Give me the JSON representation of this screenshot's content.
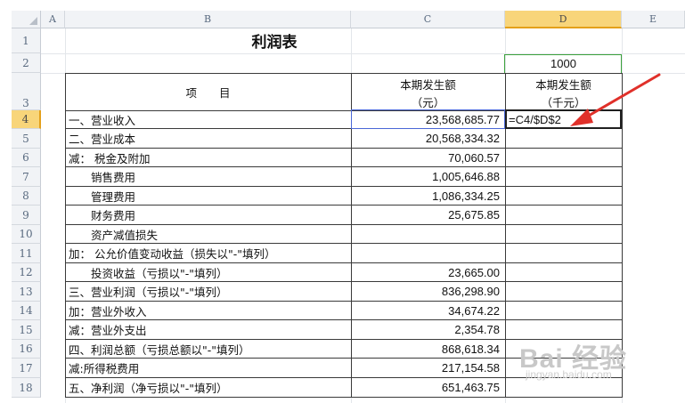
{
  "columns": [
    "A",
    "B",
    "C",
    "D",
    "E"
  ],
  "selected_column": "D",
  "rows": [
    "1",
    "2",
    "3",
    "4",
    "5",
    "6",
    "7",
    "8",
    "9",
    "10",
    "11",
    "12",
    "13",
    "14",
    "15",
    "16",
    "17",
    "18"
  ],
  "selected_row": "4",
  "sheet": {
    "title": "利润表",
    "d2_value": "1000",
    "header": {
      "item_label": "项　　目",
      "c_line1": "本期发生额",
      "c_line2": "（元）",
      "d_line1": "本期发生额",
      "d_line2": "（千元）"
    },
    "d4_formula": "=C4/$D$2",
    "lines": [
      {
        "label": "一、营业收入",
        "value": "23,568,685.77"
      },
      {
        "label": "二、营业成本",
        "value": "20,568,334.32"
      },
      {
        "label": "减：  税金及附加",
        "value": "70,060.57"
      },
      {
        "label": "　　销售费用",
        "value": "1,005,646.88"
      },
      {
        "label": "　　管理费用",
        "value": "1,086,334.25"
      },
      {
        "label": "　　财务费用",
        "value": "25,675.85"
      },
      {
        "label": "　　资产减值损失",
        "value": ""
      },
      {
        "label": "加：  公允价值变动收益（损失以\"-\"填列）",
        "value": ""
      },
      {
        "label": "　　投资收益（亏损以\"-\"填列）",
        "value": "23,665.00"
      },
      {
        "label": "三、营业利润（亏损以\"-\"填列）",
        "value": "836,298.90"
      },
      {
        "label": "加：营业外收入",
        "value": "34,674.22"
      },
      {
        "label": "减：营业外支出",
        "value": "2,354.78"
      },
      {
        "label": "四、利润总额（亏损总额以\"-\"填列）",
        "value": "868,618.34"
      },
      {
        "label": "减:所得税费用",
        "value": "217,154.58"
      },
      {
        "label": "五、净利润（净亏损以\"-\"填列）",
        "value": "651,463.75"
      }
    ]
  },
  "annotation": {
    "arrow_color": "#e0302a"
  },
  "watermark": {
    "brand": "Bai  经验",
    "site": "jingyan.baidu.com"
  }
}
